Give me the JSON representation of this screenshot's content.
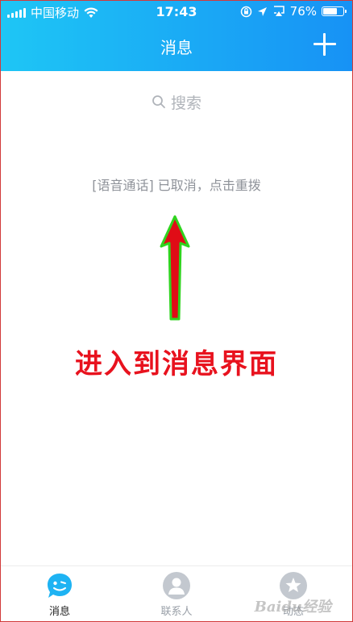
{
  "status_bar": {
    "carrier": "中国移动",
    "time": "17:43",
    "battery_text": "76%",
    "battery_level": 0.76
  },
  "header": {
    "title": "消息",
    "accent_start": "#1ec6f5",
    "accent_end": "#1792f5"
  },
  "search": {
    "placeholder": "搜索"
  },
  "messages": [
    {
      "text": "[语音通话] 已取消，点击重拨"
    }
  ],
  "annotation": {
    "text": "进入到消息界面",
    "color": "#e8121e",
    "arrow_fill": "#e00c16",
    "arrow_outline": "#2fd41f"
  },
  "tabs": [
    {
      "label": "消息",
      "icon": "chat-bubble-icon",
      "active": true
    },
    {
      "label": "联系人",
      "icon": "contact-person-icon",
      "active": false
    },
    {
      "label": "动态",
      "icon": "star-planet-icon",
      "active": false
    }
  ],
  "watermark": "Baidu经验"
}
